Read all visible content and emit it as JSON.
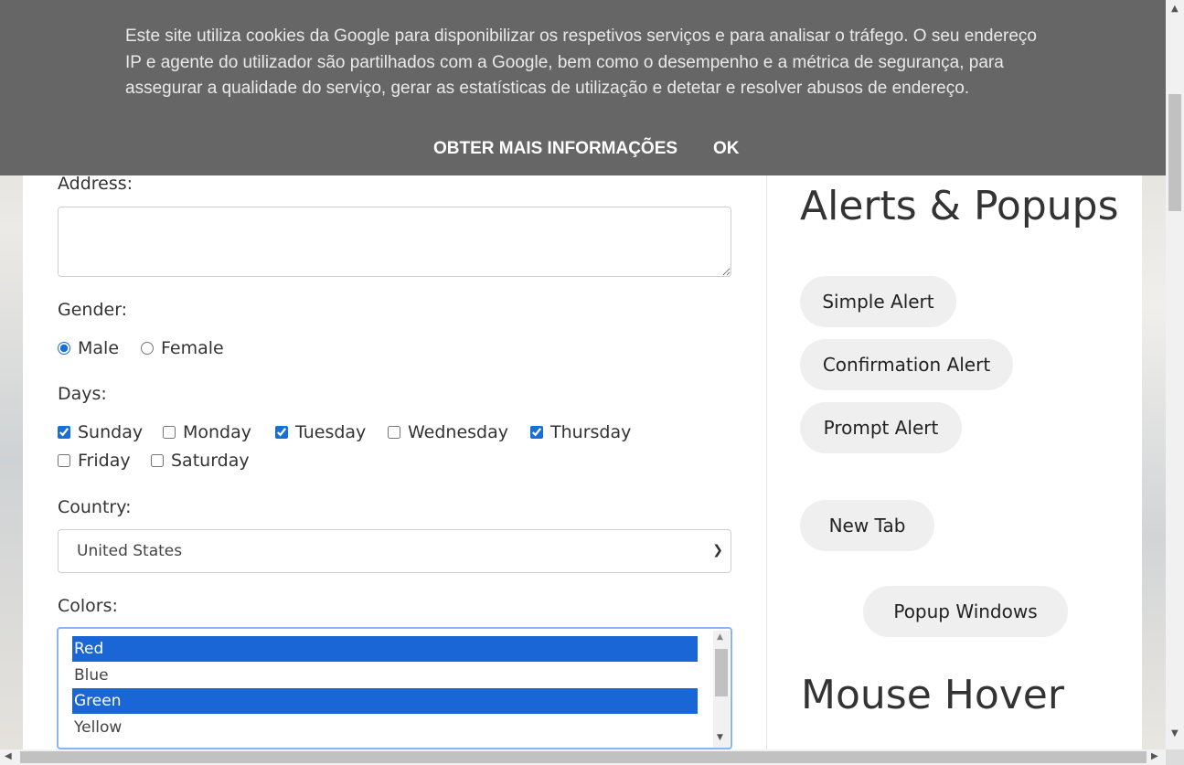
{
  "form": {
    "address_label": "Address:",
    "address_value": "",
    "gender_label": "Gender:",
    "gender_options": [
      {
        "label": "Male",
        "checked": true
      },
      {
        "label": "Female",
        "checked": false
      }
    ],
    "days_label": "Days:",
    "days": [
      {
        "label": "Sunday",
        "checked": true
      },
      {
        "label": "Monday",
        "checked": false
      },
      {
        "label": "Tuesday",
        "checked": true
      },
      {
        "label": "Wednesday",
        "checked": false
      },
      {
        "label": "Thursday",
        "checked": true
      },
      {
        "label": "Friday",
        "checked": false
      },
      {
        "label": "Saturday",
        "checked": false
      }
    ],
    "country_label": "Country:",
    "country_value": "United States",
    "colors_label": "Colors:",
    "colors": [
      {
        "label": "Red",
        "selected": true
      },
      {
        "label": "Blue",
        "selected": false
      },
      {
        "label": "Green",
        "selected": true
      },
      {
        "label": "Yellow",
        "selected": false
      }
    ]
  },
  "sidebar": {
    "alerts_heading": "Alerts & Popups",
    "buttons": {
      "simple_alert": "Simple Alert",
      "confirmation_alert": "Confirmation Alert",
      "prompt_alert": "Prompt Alert",
      "new_tab": "New Tab",
      "popup_windows": "Popup Windows"
    },
    "mouse_hover_heading": "Mouse Hover"
  },
  "cookie_banner": {
    "message": "Este site utiliza cookies da Google para disponibilizar os respetivos serviços e para analisar o tráfego. O seu endereço IP e agente do utilizador são partilhados com a Google, bem como o desempenho e a métrica de segurança, para assegurar a qualidade do serviço, gerar as estatísticas de utilização e detetar e resolver abusos de endereço.",
    "more_info": "OBTER MAIS INFORMAÇÕES",
    "ok": "OK"
  },
  "colors": {
    "banner_bg": "#666666",
    "selection": "#1a66d6",
    "pill_bg": "#efefef"
  }
}
